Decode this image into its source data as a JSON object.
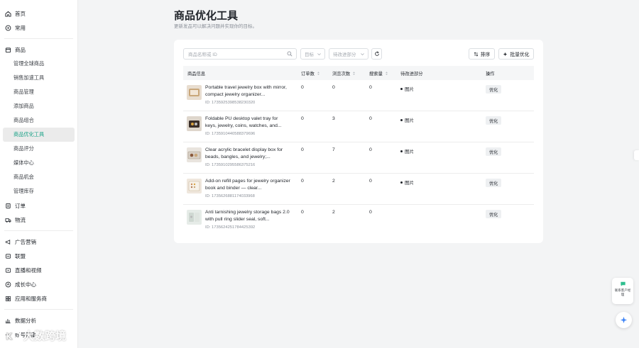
{
  "sidebar": {
    "items": [
      {
        "label": "首页",
        "icon": "home-icon"
      },
      {
        "label": "常用",
        "icon": "compass-icon"
      },
      {
        "label": "商品",
        "icon": "product-icon"
      },
      {
        "label": "管理全球商品"
      },
      {
        "label": "销售加速工具"
      },
      {
        "label": "商品管理"
      },
      {
        "label": "添加商品"
      },
      {
        "label": "商品组合"
      },
      {
        "label": "商品优化工具"
      },
      {
        "label": "商品评分"
      },
      {
        "label": "媒体中心"
      },
      {
        "label": "商品机会"
      },
      {
        "label": "管理库存"
      },
      {
        "label": "订单",
        "icon": "order-icon"
      },
      {
        "label": "物流",
        "icon": "truck-icon"
      },
      {
        "label": "广告营销",
        "icon": "megaphone-icon"
      },
      {
        "label": "联盟",
        "icon": "affiliate-icon"
      },
      {
        "label": "直播和视频",
        "icon": "video-icon"
      },
      {
        "label": "成长中心",
        "icon": "growth-icon"
      },
      {
        "label": "应用和服务商",
        "icon": "apps-icon"
      },
      {
        "label": "数据分析",
        "icon": "chart-icon"
      },
      {
        "label": "账号健康",
        "icon": "health-icon"
      }
    ]
  },
  "header": {
    "title": "商品优化工具",
    "subtitle": "更新发品可以解决问题并实现你的目标。"
  },
  "toolbar": {
    "search_placeholder": "商品名称或 ID",
    "filter_goal": "目标",
    "filter_pending": "待改进部分",
    "sort_label": "排序",
    "bulk_label": "批量优化"
  },
  "table": {
    "columns": [
      "商品信息",
      "订单数",
      "浏览次数",
      "搜索量",
      "待改进部分",
      "操作"
    ],
    "rows": [
      {
        "name": "Portable travel jewelry box with mirror, compact jewelry organizer...",
        "id": "ID: 1735925398538230320",
        "orders": "0",
        "views": "0",
        "search": "0",
        "improve": "图片",
        "action": "优化"
      },
      {
        "name": "Foldable PU desktop valet tray for keys, jewelry, coins, watches, and...",
        "id": "ID: 1735910440588379696",
        "orders": "0",
        "views": "3",
        "search": "0",
        "improve": "图片",
        "action": "优化"
      },
      {
        "name": "Clear acrylic bracelet display box for beads, bangles, and jewelry;...",
        "id": "ID: 1735910295586375216",
        "orders": "0",
        "views": "7",
        "search": "0",
        "improve": "图片",
        "action": "优化"
      },
      {
        "name": "Add-on refill pages for jewelry organizer book and binder — clear...",
        "id": "ID: 1735626881174033968",
        "orders": "0",
        "views": "2",
        "search": "0",
        "improve": "图片",
        "action": "优化"
      },
      {
        "name": "Anti tarnishing jewelry storage bags 2.0 with pull ring slider seal, soft...",
        "id": "ID: 1735624251784425392",
        "orders": "0",
        "views": "2",
        "search": "0",
        "improve": "",
        "action": "优化"
      }
    ]
  },
  "floating": {
    "contact_label": "联系客户经理"
  },
  "watermark": {
    "text": "大数跨境"
  },
  "colors": {
    "accent": "#16a085",
    "background": "#f3f4f5"
  }
}
